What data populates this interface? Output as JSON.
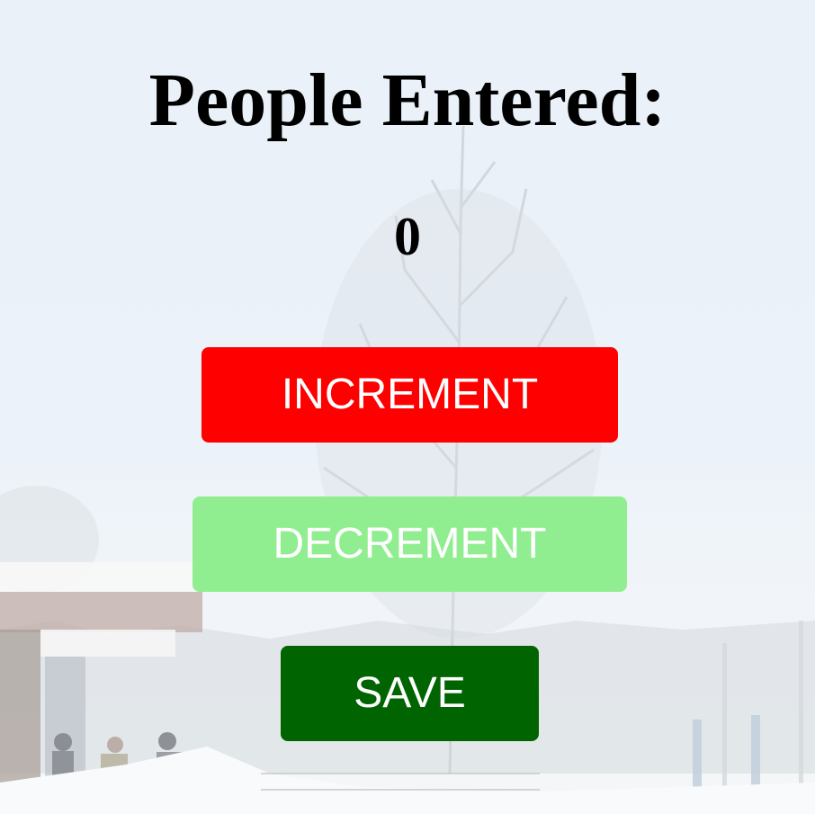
{
  "header": {
    "title": "People Entered:"
  },
  "counter": {
    "value": "0"
  },
  "buttons": {
    "increment_label": "INCREMENT",
    "decrement_label": "DECREMENT",
    "save_label": "SAVE"
  },
  "colors": {
    "increment": "#ff0000",
    "decrement": "#90ee90",
    "save": "#006400",
    "text": "#000000",
    "button_text": "#ffffff"
  },
  "background": {
    "scene": "snowy train station with bare birch tree"
  }
}
